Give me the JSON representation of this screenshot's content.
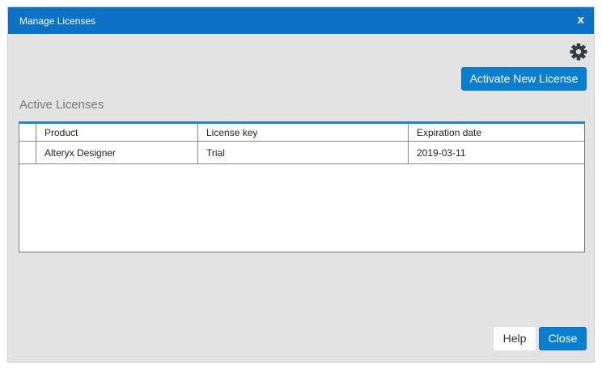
{
  "window": {
    "title": "Manage Licenses",
    "close_label": "x"
  },
  "toolbar": {
    "settings_icon": "gear-icon",
    "activate_label": "Activate New License"
  },
  "section_title": "Active Licenses",
  "table": {
    "headers": [
      "Product",
      "License key",
      "Expiration date"
    ],
    "rows": [
      [
        "Alteryx Designer",
        "Trial",
        "2019-03-11"
      ]
    ]
  },
  "footer": {
    "help_label": "Help",
    "close_label": "Close"
  }
}
